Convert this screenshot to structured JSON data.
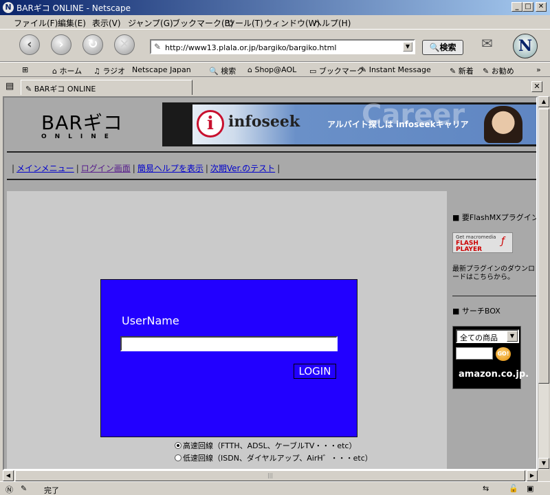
{
  "window": {
    "title": "BARギコ ONLINE - Netscape",
    "minimize": "_",
    "maximize": "□",
    "close": "✕"
  },
  "menu": [
    "ファイル(F)",
    "編集(E)",
    "表示(V)",
    "ジャンプ(G)",
    "ブックマーク(B)",
    "ツール(T)",
    "ウィンドウ(W)",
    "ヘルプ(H)"
  ],
  "nav": {
    "url": "http://www13.plala.or.jp/bargiko/bargiko.html",
    "search_label": "検索"
  },
  "personal_toolbar": [
    "ホーム",
    "ラジオ",
    "Netscape Japan",
    "検索",
    "Shop@AOL",
    "ブックマーク",
    "Instant Message",
    "新着",
    "お勧め"
  ],
  "tab": {
    "title": "BARギコ ONLINE"
  },
  "site": {
    "title": "BARギコ",
    "subtitle": "ONLINE",
    "banner": {
      "brand": "infoseek",
      "text": "アルバイト探しは infoseekキャリア",
      "watermark": "Career"
    },
    "links": [
      {
        "label": "メインメニュー"
      },
      {
        "label": "ログイン画面"
      },
      {
        "label": "簡易ヘルプを表示"
      },
      {
        "label": "次期Ver.のテスト"
      }
    ]
  },
  "login": {
    "username_label": "UserName",
    "username_value": "",
    "login_button": "LOGIN",
    "radio_fast": "高速回線（FTTH、ADSL、ケーブルTV・・・etc）",
    "radio_slow": "低速回線（ISDN、ダイヤルアップ、AirH゛・・・etc）"
  },
  "sidebar": {
    "flash_heading": "■ 要FlashMXプラグイン",
    "flash_badge": {
      "line1": "Get macromedia",
      "line2": "FLASH",
      "line3": "PLAYER"
    },
    "flash_desc": "最新プラグインのダウンロードはこちらから。",
    "search_heading": "■ サーチBOX",
    "amazon": {
      "category": "全ての商品",
      "go": "GO!",
      "brand": "amazon.co.jp."
    }
  },
  "status": {
    "text": "完了"
  }
}
